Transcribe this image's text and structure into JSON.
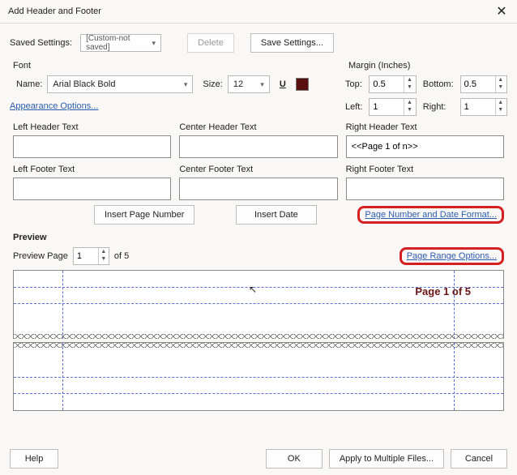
{
  "title": "Add Header and Footer",
  "saved": {
    "label": "Saved Settings:",
    "value": "[Custom-not saved]",
    "delete": "Delete",
    "save": "Save Settings..."
  },
  "font": {
    "heading": "Font",
    "name_label": "Name:",
    "name_value": "Arial Black Bold",
    "size_label": "Size:",
    "size_value": "12",
    "appearance_link": "Appearance Options..."
  },
  "margin": {
    "heading": "Margin (Inches)",
    "top_label": "Top:",
    "top_value": "0.5",
    "bottom_label": "Bottom:",
    "bottom_value": "0.5",
    "left_label": "Left:",
    "left_value": "1",
    "right_label": "Right:",
    "right_value": "1"
  },
  "headers": {
    "left_h": "Left Header Text",
    "center_h": "Center Header Text",
    "right_h": "Right Header Text",
    "left_f": "Left Footer Text",
    "center_f": "Center Footer Text",
    "right_f": "Right Footer Text",
    "left_h_val": "",
    "center_h_val": "",
    "right_h_val": "<<Page 1 of n>>",
    "left_f_val": "",
    "center_f_val": "",
    "right_f_val": ""
  },
  "insert": {
    "page_num": "Insert Page Number",
    "date": "Insert Date",
    "format_link": "Page Number and Date Format..."
  },
  "preview": {
    "heading": "Preview",
    "page_label": "Preview Page",
    "page_value": "1",
    "of_text": "of 5",
    "range_link": "Page Range Options...",
    "rendered_text": "Page 1 of 5"
  },
  "buttons": {
    "help": "Help",
    "ok": "OK",
    "apply_multi": "Apply to Multiple Files...",
    "cancel": "Cancel"
  }
}
